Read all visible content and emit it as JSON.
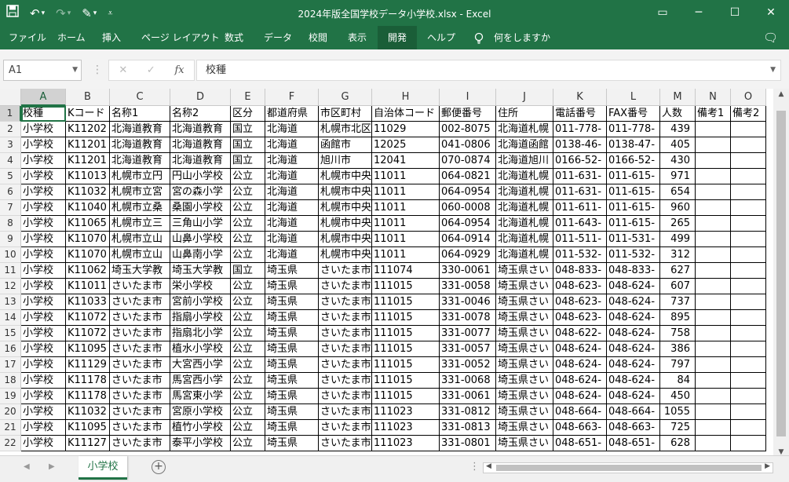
{
  "titlebar": {
    "title": "2024年版全国学校データ小学校.xlsx  -  Excel",
    "qat": {
      "save_icon": "save-icon",
      "undo_icon": "undo-icon",
      "redo_icon": "redo-icon",
      "brush_icon": "paint-brush-icon",
      "customize_icon": "qat-customize-icon"
    },
    "controls": {
      "ribbon_display": "▭",
      "minimize": "─",
      "maximize": "☐",
      "close": "✕"
    }
  },
  "ribbon": {
    "tabs": [
      "ファイル",
      "ホーム",
      "挿入",
      "ページ レイアウト",
      "数式",
      "データ",
      "校閲",
      "表示",
      "開発",
      "ヘルプ"
    ],
    "active_tab": "開発",
    "tell_me": "何をしますか",
    "colors": {
      "brand": "#217346",
      "active_tab": "#1a5e38"
    }
  },
  "formula_bar": {
    "name_box": "A1",
    "cancel": "✕",
    "enter": "✓",
    "fx": "fx",
    "content": "校種"
  },
  "grid": {
    "columns": [
      "A",
      "B",
      "C",
      "D",
      "E",
      "F",
      "G",
      "H",
      "I",
      "J",
      "K",
      "L",
      "M",
      "N",
      "O"
    ],
    "selected_column": "A",
    "selected_row": "1",
    "row_numbers": [
      "1",
      "2",
      "3",
      "4",
      "5",
      "6",
      "7",
      "8",
      "9",
      "10",
      "11",
      "12",
      "13",
      "14",
      "15",
      "16",
      "17",
      "18",
      "19",
      "20",
      "21",
      "22"
    ],
    "rows": [
      [
        "校種",
        "Kコード",
        "名称1",
        "名称2",
        "区分",
        "都道府県",
        "市区町村",
        "自治体コード",
        "郵便番号",
        "住所",
        "電話番号",
        "FAX番号",
        "人数",
        "備考1",
        "備考2"
      ],
      [
        "小学校",
        "K11202",
        "北海道教育",
        "北海道教育",
        "国立",
        "北海道",
        "札幌市北区",
        "11029",
        "002-8075",
        "北海道札幌",
        "011-778-",
        "011-778-",
        "439",
        "",
        ""
      ],
      [
        "小学校",
        "K11201",
        "北海道教育",
        "北海道教育",
        "国立",
        "北海道",
        "函館市",
        "12025",
        "041-0806",
        "北海道函館",
        "0138-46-",
        "0138-47-",
        "405",
        "",
        ""
      ],
      [
        "小学校",
        "K11201",
        "北海道教育",
        "北海道教育",
        "国立",
        "北海道",
        "旭川市",
        "12041",
        "070-0874",
        "北海道旭川",
        "0166-52-",
        "0166-52-",
        "430",
        "",
        ""
      ],
      [
        "小学校",
        "K11013",
        "札幌市立円",
        "円山小学校",
        "公立",
        "北海道",
        "札幌市中央",
        "11011",
        "064-0821",
        "北海道札幌",
        "011-631-",
        "011-615-",
        "971",
        "",
        ""
      ],
      [
        "小学校",
        "K11032",
        "札幌市立宮",
        "宮の森小学",
        "公立",
        "北海道",
        "札幌市中央",
        "11011",
        "064-0954",
        "北海道札幌",
        "011-631-",
        "011-615-",
        "654",
        "",
        ""
      ],
      [
        "小学校",
        "K11040",
        "札幌市立桑",
        "桑園小学校",
        "公立",
        "北海道",
        "札幌市中央",
        "11011",
        "060-0008",
        "北海道札幌",
        "011-611-",
        "011-615-",
        "960",
        "",
        ""
      ],
      [
        "小学校",
        "K11065",
        "札幌市立三",
        "三角山小学",
        "公立",
        "北海道",
        "札幌市中央",
        "11011",
        "064-0954",
        "北海道札幌",
        "011-643-",
        "011-615-",
        "265",
        "",
        ""
      ],
      [
        "小学校",
        "K11070",
        "札幌市立山",
        "山鼻小学校",
        "公立",
        "北海道",
        "札幌市中央",
        "11011",
        "064-0914",
        "北海道札幌",
        "011-511-",
        "011-531-",
        "499",
        "",
        ""
      ],
      [
        "小学校",
        "K11070",
        "札幌市立山",
        "山鼻南小学",
        "公立",
        "北海道",
        "札幌市中央",
        "11011",
        "064-0929",
        "北海道札幌",
        "011-532-",
        "011-532-",
        "312",
        "",
        ""
      ],
      [
        "小学校",
        "K11062",
        "埼玉大学教",
        "埼玉大学教",
        "国立",
        "埼玉県",
        "さいたま市",
        "111074",
        "330-0061",
        "埼玉県さい",
        "048-833-",
        "048-833-",
        "627",
        "",
        ""
      ],
      [
        "小学校",
        "K11011",
        "さいたま市",
        "栄小学校",
        "公立",
        "埼玉県",
        "さいたま市",
        "111015",
        "331-0058",
        "埼玉県さい",
        "048-623-",
        "048-624-",
        "607",
        "",
        ""
      ],
      [
        "小学校",
        "K11033",
        "さいたま市",
        "宮前小学校",
        "公立",
        "埼玉県",
        "さいたま市",
        "111015",
        "331-0046",
        "埼玉県さい",
        "048-623-",
        "048-624-",
        "737",
        "",
        ""
      ],
      [
        "小学校",
        "K11072",
        "さいたま市",
        "指扇小学校",
        "公立",
        "埼玉県",
        "さいたま市",
        "111015",
        "331-0078",
        "埼玉県さい",
        "048-623-",
        "048-624-",
        "895",
        "",
        ""
      ],
      [
        "小学校",
        "K11072",
        "さいたま市",
        "指扇北小学",
        "公立",
        "埼玉県",
        "さいたま市",
        "111015",
        "331-0077",
        "埼玉県さい",
        "048-622-",
        "048-624-",
        "758",
        "",
        ""
      ],
      [
        "小学校",
        "K11095",
        "さいたま市",
        "植水小学校",
        "公立",
        "埼玉県",
        "さいたま市",
        "111015",
        "331-0057",
        "埼玉県さい",
        "048-624-",
        "048-624-",
        "386",
        "",
        ""
      ],
      [
        "小学校",
        "K11129",
        "さいたま市",
        "大宮西小学",
        "公立",
        "埼玉県",
        "さいたま市",
        "111015",
        "331-0052",
        "埼玉県さい",
        "048-624-",
        "048-624-",
        "797",
        "",
        ""
      ],
      [
        "小学校",
        "K11178",
        "さいたま市",
        "馬宮西小学",
        "公立",
        "埼玉県",
        "さいたま市",
        "111015",
        "331-0068",
        "埼玉県さい",
        "048-624-",
        "048-624-",
        "84",
        "",
        ""
      ],
      [
        "小学校",
        "K11178",
        "さいたま市",
        "馬宮東小学",
        "公立",
        "埼玉県",
        "さいたま市",
        "111015",
        "331-0061",
        "埼玉県さい",
        "048-624-",
        "048-624-",
        "450",
        "",
        ""
      ],
      [
        "小学校",
        "K11032",
        "さいたま市",
        "宮原小学校",
        "公立",
        "埼玉県",
        "さいたま市",
        "111023",
        "331-0812",
        "埼玉県さい",
        "048-664-",
        "048-664-",
        "1055",
        "",
        ""
      ],
      [
        "小学校",
        "K11095",
        "さいたま市",
        "植竹小学校",
        "公立",
        "埼玉県",
        "さいたま市",
        "111023",
        "331-0813",
        "埼玉県さい",
        "048-663-",
        "048-663-",
        "725",
        "",
        ""
      ],
      [
        "小学校",
        "K11127",
        "さいたま市",
        "泰平小学校",
        "公立",
        "埼玉県",
        "さいたま市",
        "111023",
        "331-0801",
        "埼玉県さい",
        "048-651-",
        "048-651-",
        "628",
        "",
        ""
      ]
    ]
  },
  "sheetbar": {
    "active_sheet": "小学校",
    "add_sheet": "+",
    "prev": "◀",
    "next": "▶"
  }
}
